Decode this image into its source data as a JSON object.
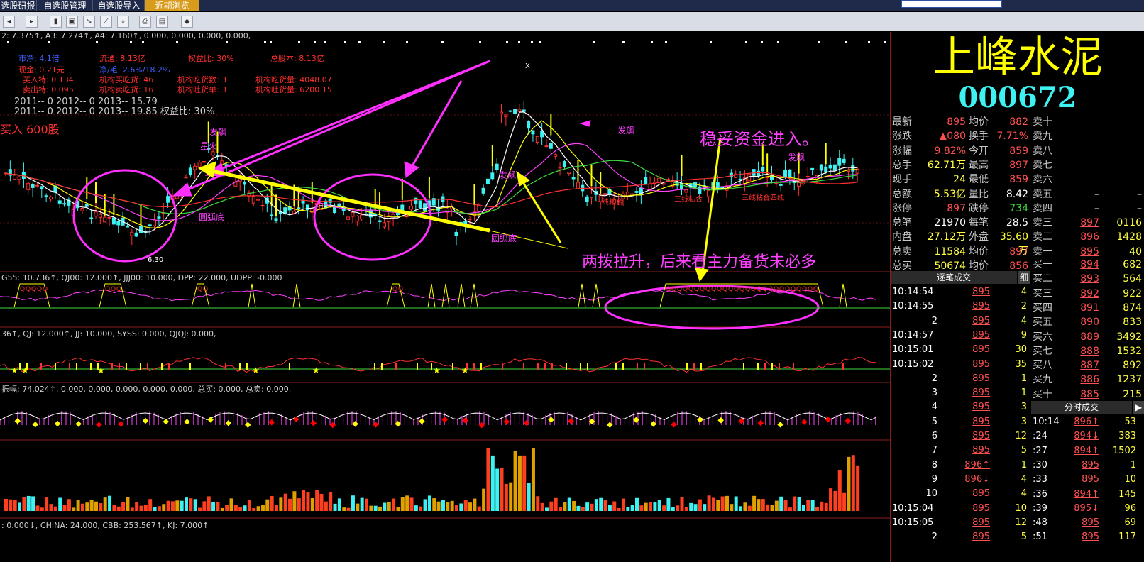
{
  "tabs": [
    "选股研报",
    "自选股管理",
    "自选股导入",
    "近期浏览"
  ],
  "top_line": "2: 7.375↑, A3: 7.274↑, A4: 7.160↑, 0.000, 0.000, 0.000, 0.000,",
  "info": {
    "r1": [
      "市净: 4.1倍",
      "流通: 8.13亿",
      "权益比: 30%",
      "总股本: 8.13亿"
    ],
    "r2": [
      "现金: 0.21元",
      "净/毛: 2.6%/18.2%"
    ],
    "r3": [
      "买入特: 0.134",
      "机构买吃货: 46",
      "机构吃货数: 3",
      "机构吃货量: 4048.07"
    ],
    "r4": [
      "卖出特: 0.095",
      "机构卖吃货: 16",
      "机构吐货单: 3",
      "机构吐货量: 6200.15"
    ],
    "r5": "2011-- 0    2012-- 0    2013-- 15.79",
    "r6": "2011-- 0    2012-- 0    2013-- 19.85    权益比: 30%",
    "buy": "买入 600股"
  },
  "annotations": {
    "a1": "稳妥资金进入。",
    "a2": "两拨拉升，后来看主力备货未必多",
    "low": "6.30",
    "x_label": "X",
    "l1": "发飙",
    "l2": "星火",
    "l3": "圆弧底",
    "l4": "圆弧底",
    "l5": "发飙",
    "l6": "发飙",
    "l7": "发飙",
    "l8": "三线粘合",
    "l9": "三线粘合",
    "l10": "三线粘合四线"
  },
  "ind1": "G55: 10.736↑, QJ00: 12.000↑, JJJ00: 10.000, DPP: 22.000, UDPP: -0.000",
  "ind2": "36↑, QJ: 12.000↑, JJ: 10.000, SYSS: 0.000, QJQJ: 0.000,",
  "ind3": "振幅: 74.024↑, 0.000, 0.000, 0.000, 0.000, 0.000, 总买: 0.000, 总卖: 0.000,",
  "ind5": ": 0.000↓, CHINA: 24.000, CBB: 253.567↑, KJ: 7.000↑",
  "side": {
    "name": "上峰水泥",
    "code": "000672",
    "quote": [
      {
        "k1": "最新",
        "v1": "895",
        "k2": "均价",
        "v2": "882"
      },
      {
        "k1": "涨跌",
        "v1": "▲080",
        "k2": "换手",
        "v2": "7.71%"
      },
      {
        "k1": "涨幅",
        "v1": "9.82%",
        "k2": "今开",
        "v2": "859"
      },
      {
        "k1": "总手",
        "v1": "62.71万",
        "k2": "最高",
        "v2": "897"
      },
      {
        "k1": "现手",
        "v1": "24",
        "k2": "最低",
        "v2": "859"
      },
      {
        "k1": "总额",
        "v1": "5.53亿",
        "k2": "量比",
        "v2": "8.42"
      },
      {
        "k1": "涨停",
        "v1": "897",
        "k2": "跌停",
        "v2": "734"
      },
      {
        "k1": "总笔",
        "v1": "21970",
        "k2": "每笔",
        "v2": "28.5"
      },
      {
        "k1": "内盘",
        "v1": "27.12万",
        "k2": "外盘",
        "v2": "35.60万"
      },
      {
        "k1": "总卖",
        "v1": "11584",
        "k2": "均价",
        "v2": "897"
      },
      {
        "k1": "总买",
        "v1": "50674",
        "k2": "均价",
        "v2": "856"
      }
    ],
    "sells": [
      {
        "l": "卖十",
        "p": "",
        "v": ""
      },
      {
        "l": "卖九",
        "p": "",
        "v": ""
      },
      {
        "l": "卖八",
        "p": "",
        "v": ""
      },
      {
        "l": "卖七",
        "p": "",
        "v": ""
      },
      {
        "l": "卖六",
        "p": "",
        "v": ""
      },
      {
        "l": "卖五",
        "p": "–",
        "v": "–"
      },
      {
        "l": "卖四",
        "p": "–",
        "v": "–"
      },
      {
        "l": "卖三",
        "p": "897",
        "v": "0116"
      },
      {
        "l": "卖二",
        "p": "896",
        "v": "1428"
      },
      {
        "l": "卖一",
        "p": "895",
        "v": "40"
      }
    ],
    "buys": [
      {
        "l": "买一",
        "p": "894",
        "v": "682"
      },
      {
        "l": "买二",
        "p": "893",
        "v": "564"
      },
      {
        "l": "买三",
        "p": "892",
        "v": "922"
      },
      {
        "l": "买四",
        "p": "891",
        "v": "874"
      },
      {
        "l": "买五",
        "p": "890",
        "v": "833"
      },
      {
        "l": "买六",
        "p": "889",
        "v": "3492"
      },
      {
        "l": "买七",
        "p": "888",
        "v": "1532"
      },
      {
        "l": "买八",
        "p": "887",
        "v": "892"
      },
      {
        "l": "买九",
        "p": "886",
        "v": "1237"
      },
      {
        "l": "买十",
        "p": "885",
        "v": "215"
      }
    ],
    "ticks_header": "逐笔成交",
    "ticks_btn": "细",
    "min_header": "分时成交",
    "ticks": [
      {
        "t": "10:14:54",
        "p": "895",
        "v": "4"
      },
      {
        "t": "10:14:55",
        "p": "895",
        "v": "2"
      },
      {
        "t": "2",
        "p": "895",
        "v": "4"
      },
      {
        "t": "10:14:57",
        "p": "895",
        "v": "9"
      },
      {
        "t": "10:15:01",
        "p": "895",
        "v": "30"
      },
      {
        "t": "10:15:02",
        "p": "895",
        "v": "35"
      },
      {
        "t": "2",
        "p": "895",
        "v": "1"
      },
      {
        "t": "3",
        "p": "895",
        "v": "1"
      },
      {
        "t": "4",
        "p": "895",
        "v": "3"
      },
      {
        "t": "5",
        "p": "895",
        "v": "3"
      },
      {
        "t": "6",
        "p": "895",
        "v": "12"
      },
      {
        "t": "7",
        "p": "895",
        "v": "5"
      },
      {
        "t": "8",
        "p": "896↑",
        "v": "1"
      },
      {
        "t": "9",
        "p": "896↓",
        "v": "4"
      },
      {
        "t": "10",
        "p": "895",
        "v": "4"
      },
      {
        "t": "10:15:04",
        "p": "895",
        "v": "10"
      },
      {
        "t": "10:15:05",
        "p": "895",
        "v": "12"
      },
      {
        "t": "2",
        "p": "895",
        "v": "5"
      }
    ],
    "mins": [
      {
        "t": "10:14",
        "p": "896↑",
        "v": "53"
      },
      {
        "t": ":24",
        "p": "894↓",
        "v": "383"
      },
      {
        "t": ":27",
        "p": "894↑",
        "v": "1502"
      },
      {
        "t": ":30",
        "p": "895",
        "v": "1"
      },
      {
        "t": ":33",
        "p": "895",
        "v": "10"
      },
      {
        "t": ":36",
        "p": "894↑",
        "v": "145"
      },
      {
        "t": ":39",
        "p": "895↓",
        "v": "96"
      },
      {
        "t": ":48",
        "p": "895",
        "v": "69"
      },
      {
        "t": ":51",
        "p": "895",
        "v": "117"
      }
    ]
  },
  "colors": {
    "up": "#ff3030",
    "down": "#3ff2f2",
    "ma": "#ffffff",
    "accent_magenta": "#ff30ff",
    "arrow_yellow": "#ffff00"
  }
}
